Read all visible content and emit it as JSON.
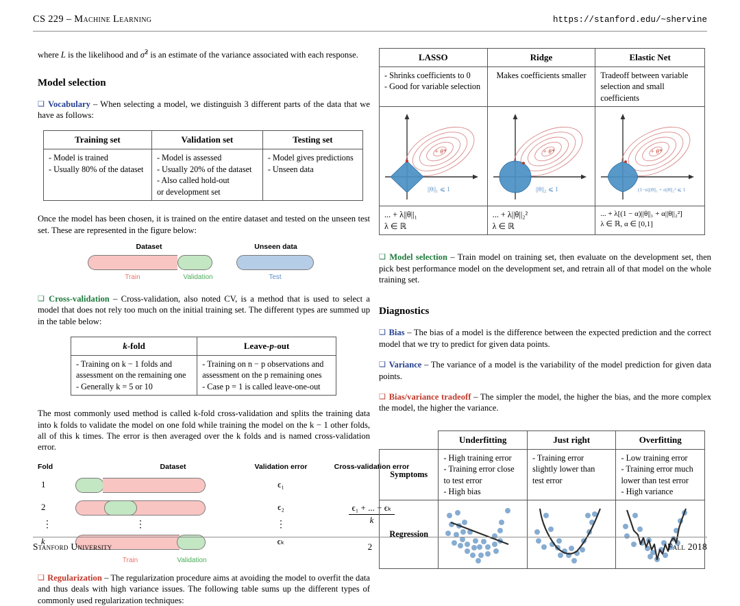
{
  "header": {
    "left": "CS 229 – Machine Learning",
    "right": "https://stanford.edu/~shervine"
  },
  "footer": {
    "left": "Stanford University",
    "center": "2",
    "right": "Fall 2018"
  },
  "left": {
    "intro": "where L is the likelihood and σ̂² is an estimate of the variance associated with each response.",
    "section_model_selection": "Model selection",
    "vocabulary_label": "Vocabulary",
    "vocabulary_text": " – When selecting a model, we distinguish 3 different parts of the data that we have as follows:",
    "table_sets": {
      "headers": [
        "Training set",
        "Validation set",
        "Testing set"
      ],
      "cells": [
        [
          "- Model is trained",
          "- Usually 80% of the dataset"
        ],
        [
          "- Model is assessed",
          "- Usually 20% of the dataset",
          "- Also called hold-out",
          "or development set"
        ],
        [
          "- Model gives predictions",
          "- Unseen data"
        ]
      ]
    },
    "after_table_text": "Once the model has been chosen, it is trained on the entire dataset and tested on the unseen test set. These are represented in the figure below:",
    "dataset_figure": {
      "dataset_caption": "Dataset",
      "unseen_caption": "Unseen data",
      "train_label": "Train",
      "validation_label": "Validation",
      "test_label": "Test",
      "train_pct": 72,
      "validation_pct": 28,
      "colors": {
        "train": "#f9c5c2",
        "validation": "#c3e6c3",
        "test": "#b6cde8"
      }
    },
    "crossval_label": "Cross-validation",
    "crossval_text": " – Cross-validation, also noted CV, is a method that is used to select a model that does not rely too much on the initial training set. The different types are summed up in the table below:",
    "table_cv": {
      "headers": [
        "k-fold",
        "Leave-p-out"
      ],
      "cells": [
        [
          "- Training on k − 1 folds and",
          "assessment on the remaining one",
          "- Generally k = 5 or 10"
        ],
        [
          "- Training on n − p observations and",
          "assessment on the p remaining ones",
          "- Case p = 1 is called leave-one-out"
        ]
      ]
    },
    "kfold_paragraph": "The most commonly used method is called k-fold cross-validation and splits the training data into k folds to validate the model on one fold while training the model on the k − 1 other folds, all of this k times. The error is then averaged over the k folds and is named cross-validation error.",
    "fold_figure": {
      "col_headers": [
        "Fold",
        "Dataset",
        "Validation error",
        "Cross-validation error"
      ],
      "rows": [
        {
          "fold": "1",
          "error": "ϵ₁",
          "val_start": 0,
          "val_width": 22
        },
        {
          "fold": "2",
          "error": "ϵ₂",
          "val_start": 22,
          "val_width": 22
        },
        {
          "fold": "⋮",
          "error": "⋮",
          "val_start": -1,
          "val_width": 0
        },
        {
          "fold": "k",
          "error": "ϵₖ",
          "val_start": 78,
          "val_width": 22
        }
      ],
      "cv_error_numerator": "ϵ₁ + ... + ϵₖ",
      "cv_error_denominator": "k",
      "train_label": "Train",
      "validation_label": "Validation"
    },
    "regularization_label": "Regularization",
    "regularization_text": " – The regularization procedure aims at avoiding the model to overfit the data and thus deals with high variance issues. The following table sums up the different types of commonly used regularization techniques:"
  },
  "right": {
    "table_reg": {
      "headers": [
        "LASSO",
        "Ridge",
        "Elastic Net"
      ],
      "descriptions": [
        [
          "- Shrinks coefficients to 0",
          "- Good for variable selection"
        ],
        [
          "Makes coefficients smaller"
        ],
        [
          "Tradeoff between variable",
          "selection and small coefficients"
        ]
      ],
      "constraint_labels": [
        "||θ||₁ ⩽ 1",
        "||θ||₂ ⩽ 1",
        "(1−α)||θ||₁ + α||θ||₂² ⩽ 1"
      ],
      "formulas": [
        {
          "line1": "... + λ||θ||₁",
          "line2": "λ ∈ ℝ"
        },
        {
          "line1": "... + λ||θ||₂²",
          "line2": "λ ∈ ℝ"
        },
        {
          "line1": "... + λ[(1 − α)||θ||₁ + α||θ||₂²]",
          "line2": "λ ∈ ℝ,   α ∈ [0,1]"
        }
      ],
      "theta_star": "θ*",
      "shapes": [
        "diamond",
        "circle",
        "rounded-diamond"
      ],
      "colors": {
        "region": "#4a90c4",
        "contour": "#d98b8b",
        "axis": "#333333"
      }
    },
    "model_selection_label": "Model selection",
    "model_selection_text": " – Train model on training set, then evaluate on the development set, then pick best performance model on the development set, and retrain all of that model on the whole training set.",
    "section_diagnostics": "Diagnostics",
    "bias_label": "Bias",
    "bias_text": " – The bias of a model is the difference between the expected prediction and the correct model that we try to predict for given data points.",
    "variance_label": "Variance",
    "variance_text": " – The variance of a model is the variability of the model prediction for given data points.",
    "tradeoff_label": "Bias/variance tradeoff",
    "tradeoff_text": " – The simpler the model, the higher the bias, and the more complex the model, the higher the variance.",
    "table_fit": {
      "headers": [
        "",
        "Underfitting",
        "Just right",
        "Overfitting"
      ],
      "row_labels": [
        "Symptoms",
        "Regression"
      ],
      "symptoms": [
        [
          "- High training error",
          "- Training error close",
          "to test error",
          "- High bias"
        ],
        [
          "- Training error",
          "slightly lower than",
          "test error"
        ],
        [
          "- Low training error",
          "- Training error much",
          "lower than test error",
          "- High variance"
        ]
      ],
      "regression_plots": [
        "linear-underfit",
        "parabola-just-right",
        "wiggly-overfit"
      ],
      "plot_colors": {
        "points": "#7fa8d0",
        "curve": "#2b2b2b"
      }
    }
  }
}
